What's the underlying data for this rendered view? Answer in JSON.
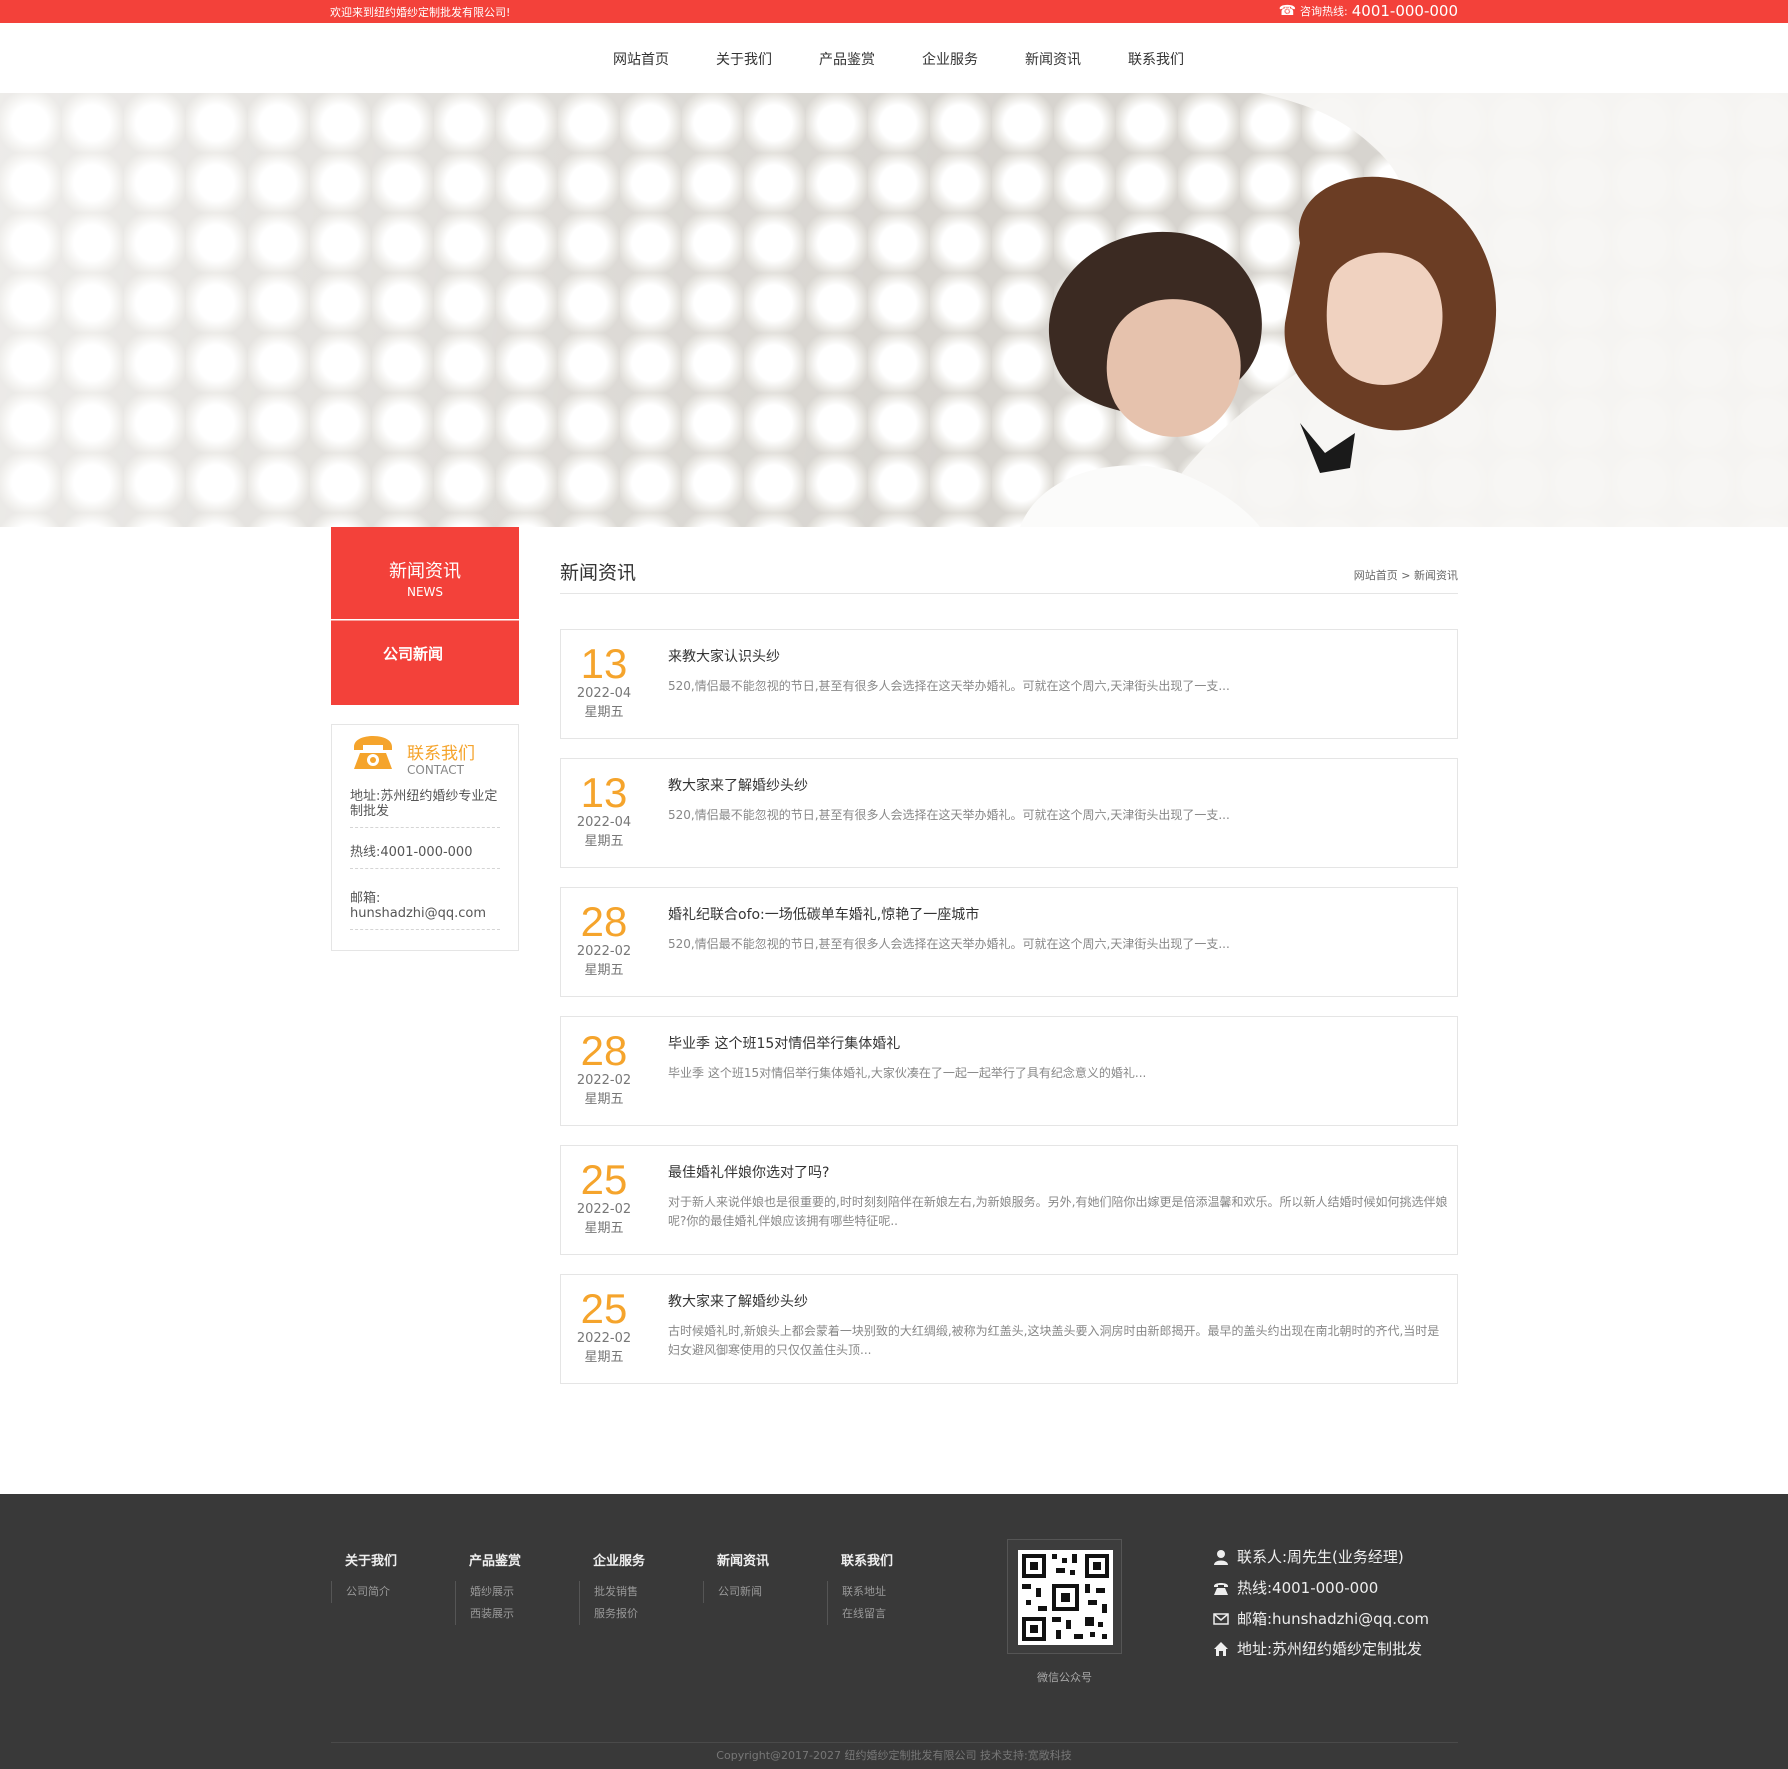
{
  "topbar": {
    "welcome": "欢迎来到纽约婚纱定制批发有限公司!",
    "hotline_label": "咨询热线:",
    "hotline_number": "4001-000-000"
  },
  "nav": {
    "items": [
      "网站首页",
      "关于我们",
      "产品鉴赏",
      "企业服务",
      "新闻资讯",
      "联系我们"
    ]
  },
  "sidebar": {
    "title": "新闻资讯",
    "title_en": "NEWS",
    "category": "公司新闻",
    "contact": {
      "title": "联系我们",
      "title_en": "CONTACT",
      "address": "地址:苏州纽约婚纱专业定制批发",
      "hotline": "热线:4001-000-000",
      "email_label": "邮箱:",
      "email": "hunshadzhi@qq.com"
    }
  },
  "main": {
    "title": "新闻资讯",
    "breadcrumb": "网站首页 > 新闻资讯",
    "news": [
      {
        "day": "13",
        "date": "2022-04",
        "week": "星期五",
        "title": "来教大家认识头纱",
        "summary": "520,情侣最不能忽视的节日,甚至有很多人会选择在这天举办婚礼。可就在这个周六,天津街头出现了一支..."
      },
      {
        "day": "13",
        "date": "2022-04",
        "week": "星期五",
        "title": "教大家来了解婚纱头纱",
        "summary": "520,情侣最不能忽视的节日,甚至有很多人会选择在这天举办婚礼。可就在这个周六,天津街头出现了一支..."
      },
      {
        "day": "28",
        "date": "2022-02",
        "week": "星期五",
        "title": "婚礼纪联合ofo:一场低碳单车婚礼,惊艳了一座城市",
        "summary": "520,情侣最不能忽视的节日,甚至有很多人会选择在这天举办婚礼。可就在这个周六,天津街头出现了一支..."
      },
      {
        "day": "28",
        "date": "2022-02",
        "week": "星期五",
        "title": "毕业季 这个班15对情侣举行集体婚礼",
        "summary": "毕业季 这个班15对情侣举行集体婚礼,大家伙凑在了一起一起举行了具有纪念意义的婚礼..."
      },
      {
        "day": "25",
        "date": "2022-02",
        "week": "星期五",
        "title": "最佳婚礼伴娘你选对了吗?",
        "summary": "对于新人来说伴娘也是很重要的,时时刻刻陪伴在新娘左右,为新娘服务。另外,有她们陪你出嫁更是倍添温馨和欢乐。所以新人结婚时候如何挑选伴娘呢?你的最佳婚礼伴娘应该拥有哪些特征呢.."
      },
      {
        "day": "25",
        "date": "2022-02",
        "week": "星期五",
        "title": "教大家来了解婚纱头纱",
        "summary": "古时候婚礼时,新娘头上都会蒙着一块别致的大红绸缎,被称为红盖头,这块盖头要入洞房时由新郎揭开。最早的盖头约出现在南北朝时的齐代,当时是妇女避风御寒使用的只仅仅盖住头顶..."
      }
    ]
  },
  "footer": {
    "columns": [
      {
        "heading": "关于我们",
        "links": [
          "公司简介"
        ]
      },
      {
        "heading": "产品鉴赏",
        "links": [
          "婚纱展示",
          "西装展示"
        ]
      },
      {
        "heading": "企业服务",
        "links": [
          "批发销售",
          "服务报价"
        ]
      },
      {
        "heading": "新闻资讯",
        "links": [
          "公司新闻"
        ]
      },
      {
        "heading": "联系我们",
        "links": [
          "联系地址",
          "在线留言"
        ]
      }
    ],
    "qr_label": "微信公众号",
    "contact_person": "联系人:周先生(业务经理)",
    "hotline": "热线:4001-000-000",
    "email": "邮箱:hunshadzhi@qq.com",
    "address": "地址:苏州纽约婚纱定制批发",
    "copyright": "Copyright@2017-2027 纽约婚纱定制批发有限公司  技术支持:宽敞科技"
  },
  "colors": {
    "brand_red": "#f3413a",
    "accent_orange": "#f5a42c",
    "footer_bg": "#393939"
  }
}
